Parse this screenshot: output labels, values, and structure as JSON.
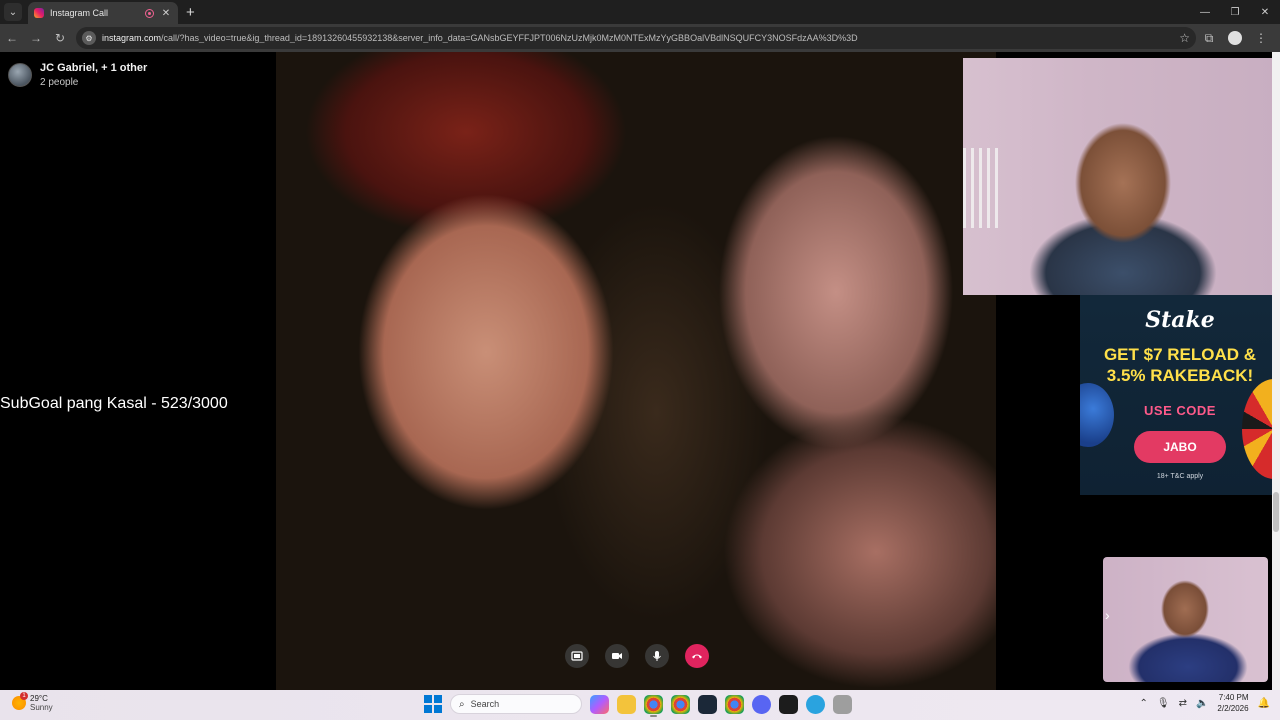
{
  "browser": {
    "tab_title": "Instagram Call",
    "url_host": "instagram.com",
    "url_path": "/call/?has_video=true&ig_thread_id=18913260455932138&server_info_data=GANsbGEYFFJPT006NzUzMjk0MzM0NTExMzYyGBBOalVBdlNSQUFCY3NOSFdzAA%3D%3D"
  },
  "call": {
    "caller_name": "JC Gabriel, + 1 other",
    "people_count": "2 people"
  },
  "overlay": {
    "subgoal": "SubGoal pang Kasal - 523/3000"
  },
  "ad": {
    "brand": "Stake",
    "headline_1": "GET $7 RELOAD &",
    "headline_2": "3.5% RAKEBACK!",
    "use_code": "USE CODE",
    "code": "JABO",
    "terms": "18+ T&C apply"
  },
  "taskbar": {
    "temperature": "29°C",
    "condition": "Sunny",
    "weather_badge": "1",
    "search_label": "Search",
    "time": "7:40 PM",
    "date": "2/2/2026"
  },
  "colors": {
    "end_call": "#e0245e",
    "ad_headline": "#ffe04a",
    "ad_button": "#e33a63"
  }
}
